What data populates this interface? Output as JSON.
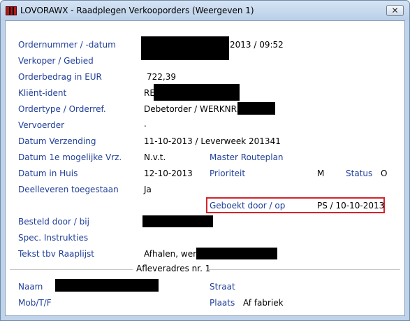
{
  "window": {
    "title": "LOVORAWX - Raadplegen Verkooporders (Weergeven 1)",
    "close_glyph": "✕",
    "app_icon": "app-logo-icon",
    "colors": {
      "label": "#1f3f99",
      "highlight_border": "#d6232a"
    }
  },
  "fields": {
    "ordernummer": {
      "label": "Ordernummer / -datum",
      "value": "2013 / 09:52"
    },
    "verkoper": {
      "label": "Verkoper / Gebied"
    },
    "orderbedrag": {
      "label": "Orderbedrag in EUR",
      "value": "722,39"
    },
    "klient": {
      "label": "Kliënt-ident",
      "value": "RE"
    },
    "ordertype": {
      "label": "Ordertype / Orderref.",
      "value": "Debetorder / WERKNR."
    },
    "vervoerder": {
      "label": "Vervoerder",
      "value": "."
    },
    "datum_verzending": {
      "label": "Datum Verzending",
      "value": "11-10-2013 / Leverweek 201341"
    },
    "datum_1e": {
      "label": "Datum 1e mogelijke Vrz.",
      "value": "N.v.t."
    },
    "master_routeplan": {
      "label": "Master Routeplan"
    },
    "datum_in_huis": {
      "label": "Datum in Huis",
      "value": "12-10-2013"
    },
    "prioriteit": {
      "label": "Prioriteit",
      "value": "M"
    },
    "status": {
      "label": "Status",
      "value": "O"
    },
    "deelleveren": {
      "label": "Deelleveren toegestaan",
      "value": "Ja"
    },
    "geboekt": {
      "label": "Geboekt door / op",
      "value": "PS / 10-10-2013"
    },
    "besteld": {
      "label": "Besteld door / bij"
    },
    "spec_instructies": {
      "label": "Spec. Instrukties"
    },
    "tekst_raaplijst": {
      "label": "Tekst tbv Raaplijst",
      "value": "Afhalen, werk"
    }
  },
  "afleveradres": {
    "heading": "Afleveradres nr. 1",
    "naam": {
      "label": "Naam"
    },
    "mob": {
      "label": "Mob/T/F"
    },
    "straat": {
      "label": "Straat"
    },
    "plaats": {
      "label": "Plaats",
      "value": "Af fabriek"
    }
  }
}
